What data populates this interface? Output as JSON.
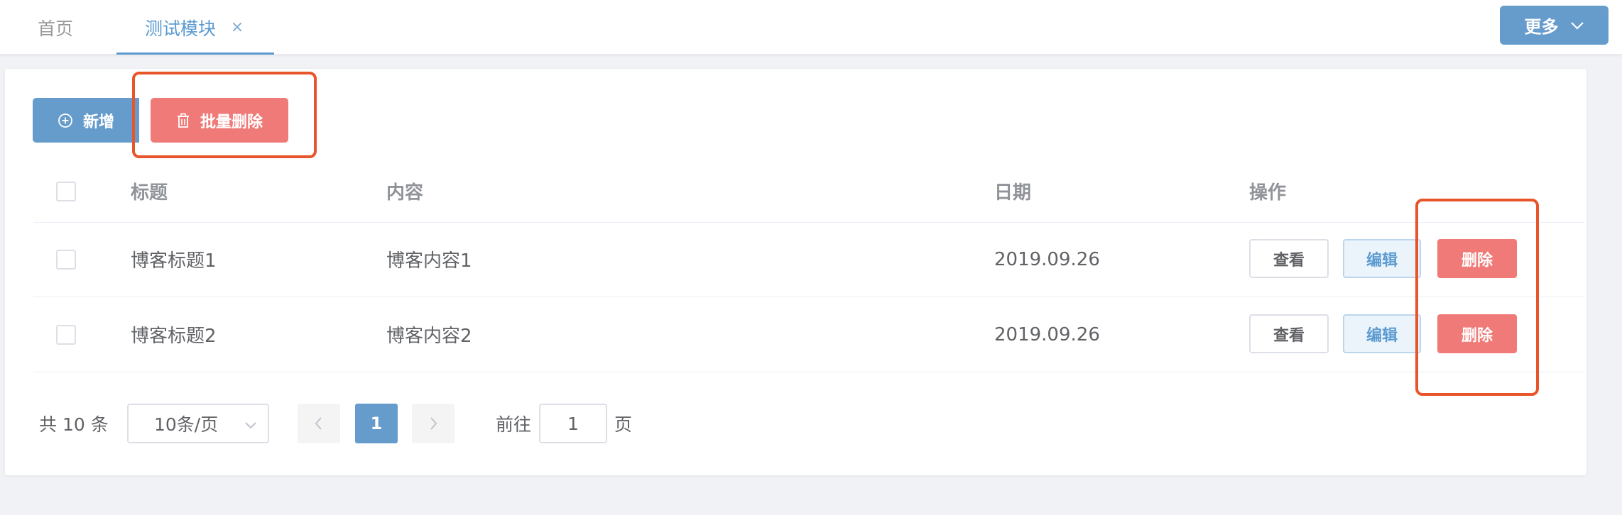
{
  "tabs": {
    "home_label": "首页",
    "active_label": "测试模块",
    "close_glyph": "×",
    "more_label": "更多"
  },
  "toolbar": {
    "add_label": "新增",
    "batch_delete_label": "批量删除"
  },
  "table": {
    "headers": {
      "title": "标题",
      "content": "内容",
      "date": "日期",
      "ops": "操作"
    },
    "rows": [
      {
        "title": "博客标题1",
        "content": "博客内容1",
        "date": "2019.09.26"
      },
      {
        "title": "博客标题2",
        "content": "博客内容2",
        "date": "2019.09.26"
      }
    ],
    "actions": {
      "view": "查看",
      "edit": "编辑",
      "delete": "删除"
    }
  },
  "pagination": {
    "total_text": "共 10 条",
    "page_size": "10条/页",
    "current_page": "1",
    "goto_label": "前往",
    "goto_value": "1",
    "page_suffix": "页"
  },
  "colors": {
    "primary": "#669ccc",
    "danger": "#ef7a77",
    "highlight": "#e9552a"
  },
  "icons": {
    "add": "plus-circle-icon",
    "batch_delete": "trash-icon",
    "more": "chevron-down-icon",
    "prev": "chevron-left-icon",
    "next": "chevron-right-icon"
  }
}
